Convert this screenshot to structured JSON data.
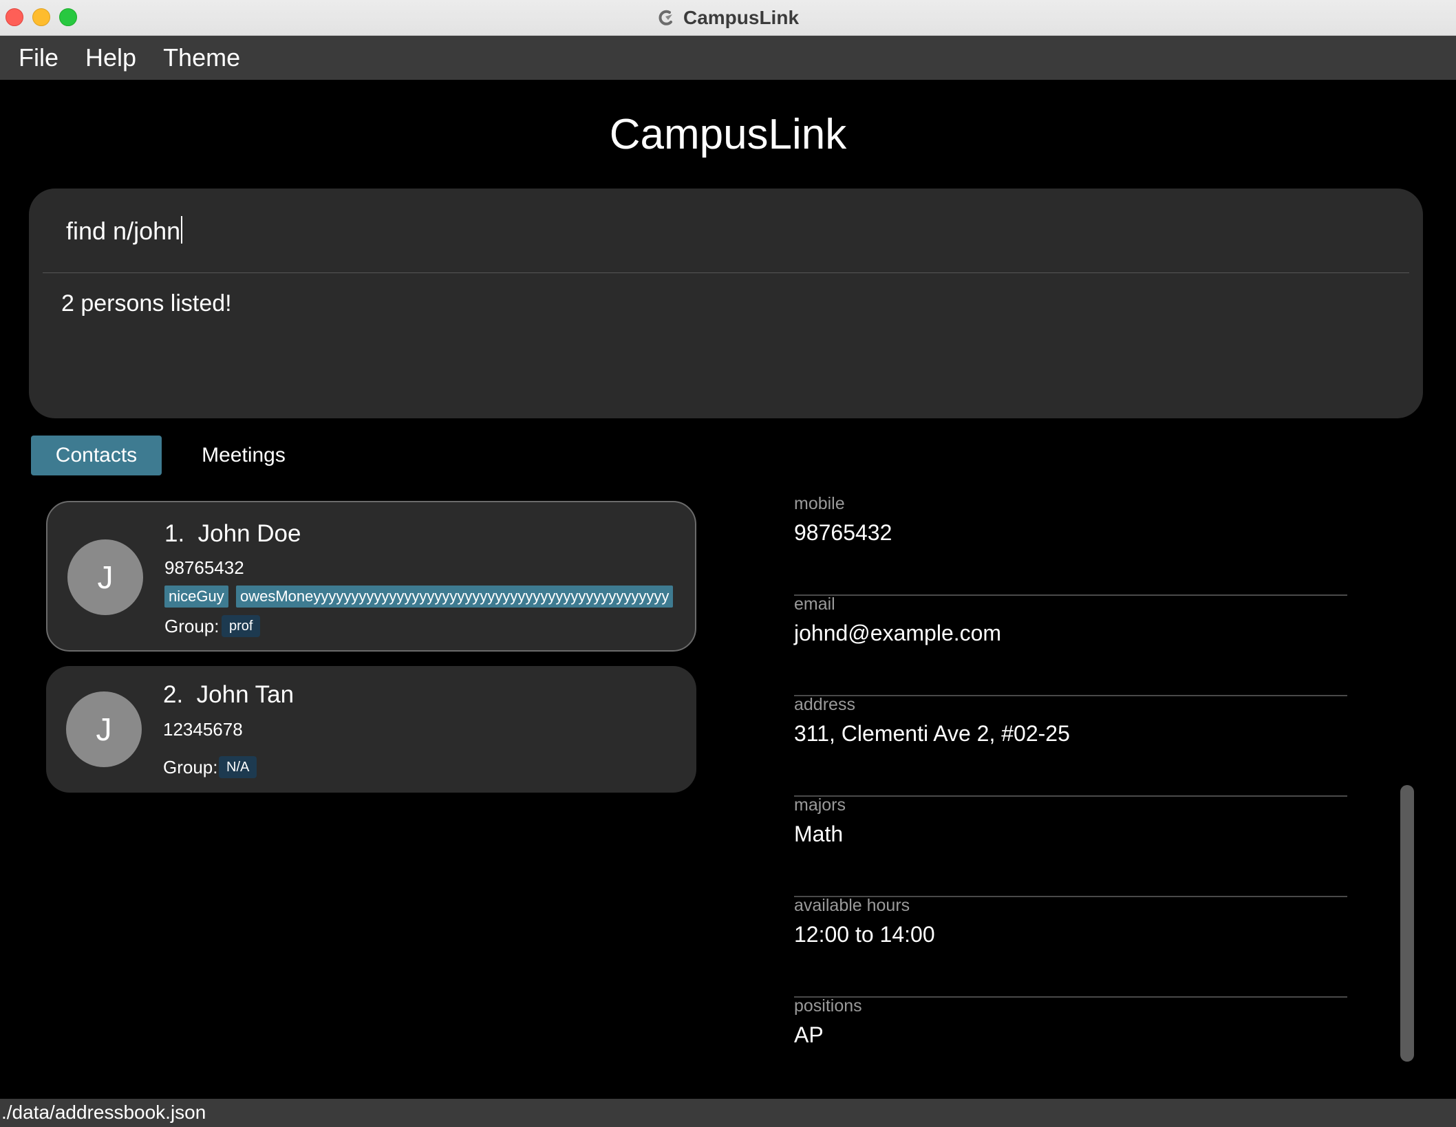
{
  "window": {
    "title": "CampusLink"
  },
  "menu": {
    "items": [
      "File",
      "Help",
      "Theme"
    ]
  },
  "app_heading": "CampusLink",
  "command": {
    "input_value": "find n/john",
    "result": "2 persons listed!"
  },
  "tabs": [
    {
      "label": "Contacts",
      "active": true
    },
    {
      "label": "Meetings",
      "active": false
    }
  ],
  "persons": [
    {
      "index": "1.",
      "name": "John Doe",
      "initial": "J",
      "phone": "98765432",
      "tags": [
        "niceGuy",
        "owesMoneyyyyyyyyyyyyyyyyyyyyyyyyyyyyyyyyyyyyyyyyyyyyyyy"
      ],
      "group_label": "Group:",
      "group": "prof"
    },
    {
      "index": "2.",
      "name": "John Tan",
      "initial": "J",
      "phone": "12345678",
      "tags": [],
      "group_label": "Group:",
      "group": "N/A"
    }
  ],
  "details": [
    {
      "label": "mobile",
      "value": "98765432"
    },
    {
      "label": "email",
      "value": "johnd@example.com"
    },
    {
      "label": "address",
      "value": "311, Clementi Ave 2, #02-25"
    },
    {
      "label": "majors",
      "value": "Math"
    },
    {
      "label": "available hours",
      "value": "12:00 to 14:00"
    },
    {
      "label": "positions",
      "value": "AP"
    }
  ],
  "status": {
    "file_path": "./data/addressbook.json"
  },
  "colors": {
    "accent": "#3e7b91",
    "group_chip": "#1d3a50",
    "panel": "#2b2b2b",
    "menubar": "#3b3b3b"
  }
}
